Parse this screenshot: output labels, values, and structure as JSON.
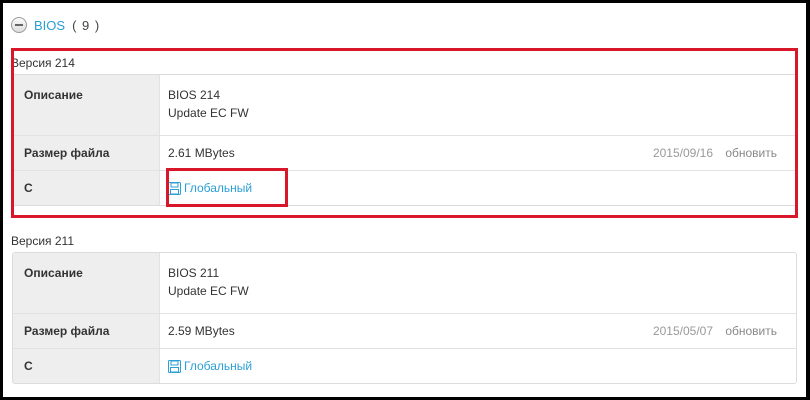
{
  "section": {
    "title": "BIOS",
    "count": "( 9 )"
  },
  "colors": {
    "accent": "#2b9fd6",
    "highlight": "#d8182a",
    "label_bg": "#eeeeee"
  },
  "versions": [
    {
      "label": "Версия 214",
      "description_key": "Описание",
      "description_line1": "BIOS 214",
      "description_line2": "Update EC FW",
      "size_key": "Размер файла",
      "size": "2.61 MBytes",
      "date": "2015/09/16",
      "update_label": "обновить",
      "source_key": "С",
      "download_label": "Глобальный",
      "download_icon": "floppy-disk-icon"
    },
    {
      "label": "Версия 211",
      "description_key": "Описание",
      "description_line1": "BIOS 211",
      "description_line2": "Update EC FW",
      "size_key": "Размер файла",
      "size": "2.59 MBytes",
      "date": "2015/05/07",
      "update_label": "обновить",
      "source_key": "С",
      "download_label": "Глобальный",
      "download_icon": "floppy-disk-icon"
    }
  ]
}
